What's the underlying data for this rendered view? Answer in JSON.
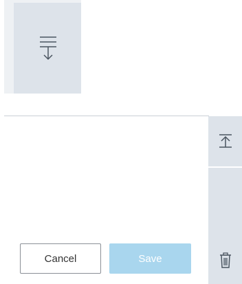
{
  "panel_top": {
    "expand_icon": "expand-down-lines-icon"
  },
  "side_rail": {
    "collapse_icon": "collapse-up-icon",
    "delete_icon": "trash-icon"
  },
  "actions": {
    "cancel_label": "Cancel",
    "save_label": "Save"
  },
  "colors": {
    "panel_bg": "#dde3ea",
    "save_disabled_bg": "#a9d6ee",
    "icon_color": "#4a5560"
  }
}
